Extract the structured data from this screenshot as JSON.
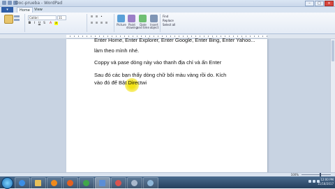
{
  "window": {
    "title": "Doc-prueba - WordPad"
  },
  "tabs": {
    "file": "",
    "home": "Home",
    "view": "View"
  },
  "ribbon": {
    "font_name": "Calibri",
    "font_size": "11",
    "insert": [
      "Picture",
      "Paint drawing",
      "Date and time",
      "Insert object"
    ],
    "editing": [
      "Find",
      "Replace",
      "Select all"
    ]
  },
  "document": {
    "lines": [
      "Enter Home, Enter Explorer, Enter Google, Enter Bing, Enter Yahoo...",
      "làm theo mình nhé.",
      "Coppy và pase dòng này vào thanh địa chỉ và ấn Enter",
      "Sau đó các bạn thấy dòng chữ bôi màu vàng rồi do. Kích",
      "vào đó để Bật Directwi"
    ]
  },
  "status": {
    "zoom": "100%"
  },
  "tray": {
    "time": "12:00 PM",
    "date": "11/18/2017"
  },
  "colors": {
    "highlight": "#f3e315",
    "file_tab": "#2f5ea8",
    "taskbar": "#2b4a6d"
  }
}
